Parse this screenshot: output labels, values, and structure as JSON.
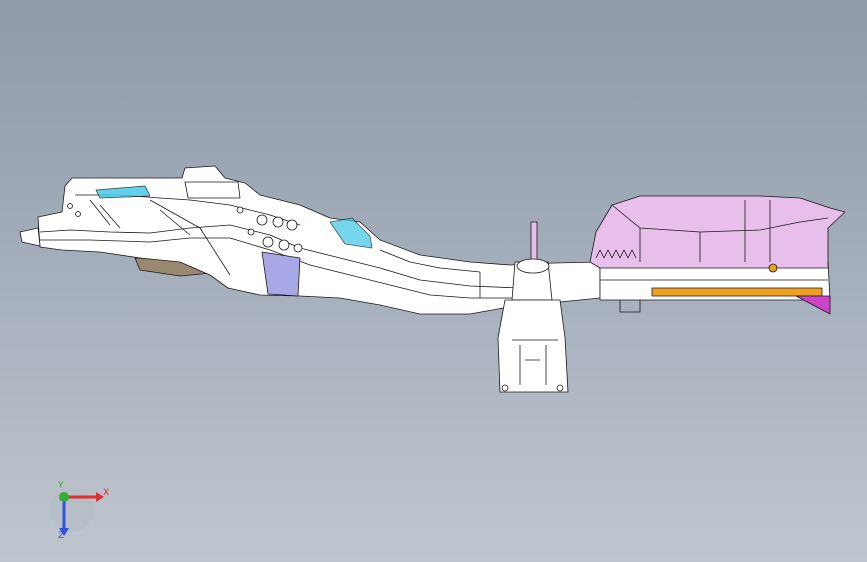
{
  "viewport": {
    "background_top": "#8e9aaa",
    "background_bottom": "#bfc6cf"
  },
  "model": {
    "frame_color": "#ffffff",
    "edge_color": "#1a1a1a",
    "accent_cyan": "#46c8e6",
    "accent_blue": "#a9a8e6",
    "accent_pink": "#e7bfea",
    "accent_orange": "#f0a020",
    "accent_magenta": "#cc44cc"
  },
  "triad": {
    "x_label": "X",
    "y_label": "Y",
    "z_label": "Z",
    "x_color": "#e03030",
    "y_color": "#2fb02f",
    "z_color": "#3050e0"
  }
}
